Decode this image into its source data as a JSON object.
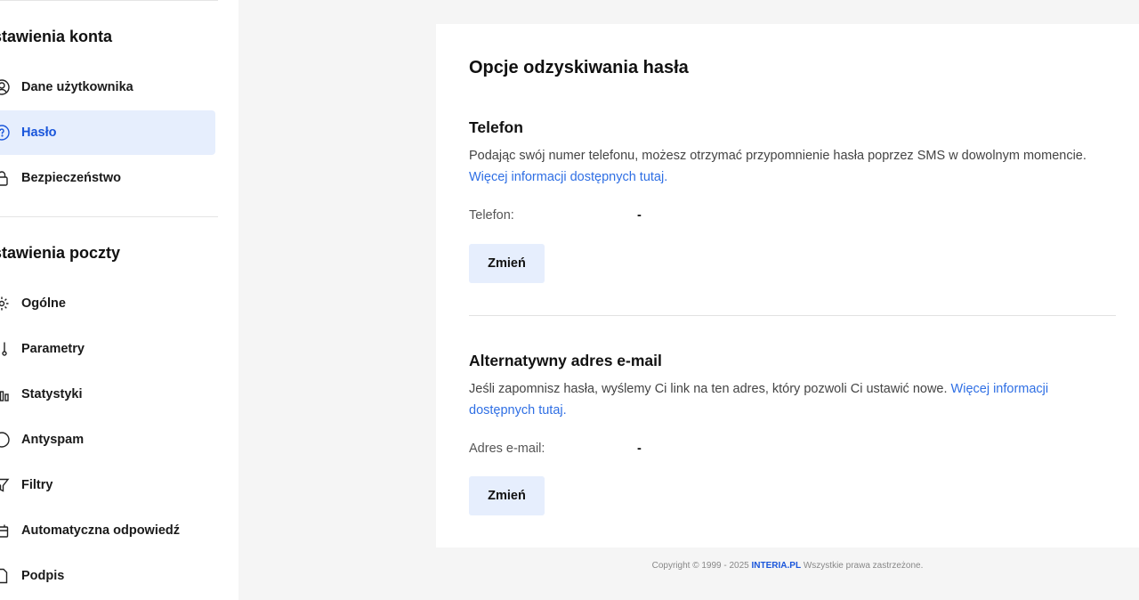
{
  "sidebar": {
    "account_section_title": "stawienia konta",
    "mail_section_title": "stawienia poczty",
    "account_items": [
      {
        "label": "Dane użytkownika",
        "icon": "user-icon"
      },
      {
        "label": "Hasło",
        "icon": "key-icon",
        "active": true
      },
      {
        "label": "Bezpieczeństwo",
        "icon": "lock-icon"
      }
    ],
    "mail_items": [
      {
        "label": "Ogólne",
        "icon": "gear-icon"
      },
      {
        "label": "Parametry",
        "icon": "sliders-icon"
      },
      {
        "label": "Statystyki",
        "icon": "bar-chart-icon"
      },
      {
        "label": "Antyspam",
        "icon": "shield-icon"
      },
      {
        "label": "Filtry",
        "icon": "filter-icon"
      },
      {
        "label": "Automatyczna odpowiedź",
        "icon": "auto-reply-icon"
      },
      {
        "label": "Podpis",
        "icon": "signature-icon"
      }
    ]
  },
  "main": {
    "title": "Opcje odzyskiwania hasła",
    "phone": {
      "title": "Telefon",
      "description": "Podając swój numer telefonu, możesz otrzymać przypomnienie hasła poprzez SMS w dowolnym momencie.",
      "link": "Więcej informacji dostępnych tutaj.",
      "field_label": "Telefon:",
      "field_value": "-",
      "button": "Zmień"
    },
    "email": {
      "title": "Alternatywny adres e-mail",
      "description": "Jeśli zapomnisz hasła, wyślemy Ci link na ten adres, który pozwoli Ci ustawić nowe.",
      "link": "Więcej informacji dostępnych tutaj.",
      "field_label": "Adres e-mail:",
      "field_value": "-",
      "button": "Zmień"
    }
  },
  "footer": {
    "prefix": "Copyright © 1999 - 2025",
    "brand": "INTERIA.PL",
    "suffix": "Wszystkie prawa zastrzeżone."
  },
  "colors": {
    "accent": "#1a56db",
    "active_bg": "#e6eefd",
    "link": "#2f6fe4"
  }
}
